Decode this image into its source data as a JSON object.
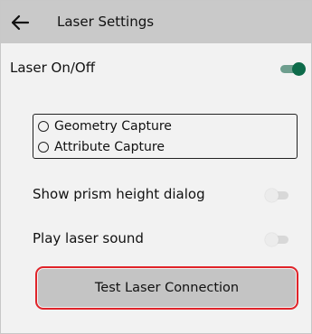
{
  "header": {
    "title": "Laser Settings",
    "back_icon": "arrow-left-icon"
  },
  "laser_toggle": {
    "label": "Laser On/Off",
    "state": "on",
    "color": "#0e6b4a"
  },
  "capture_mode": {
    "options": [
      {
        "label": "Geometry Capture",
        "selected": false
      },
      {
        "label": "Attribute Capture",
        "selected": false
      }
    ]
  },
  "prism_dialog_toggle": {
    "label": "Show prism height dialog",
    "state": "off"
  },
  "laser_sound_toggle": {
    "label": "Play laser sound",
    "state": "off"
  },
  "test_button": {
    "label": "Test Laser Connection",
    "highlight_color": "#e0242a"
  }
}
